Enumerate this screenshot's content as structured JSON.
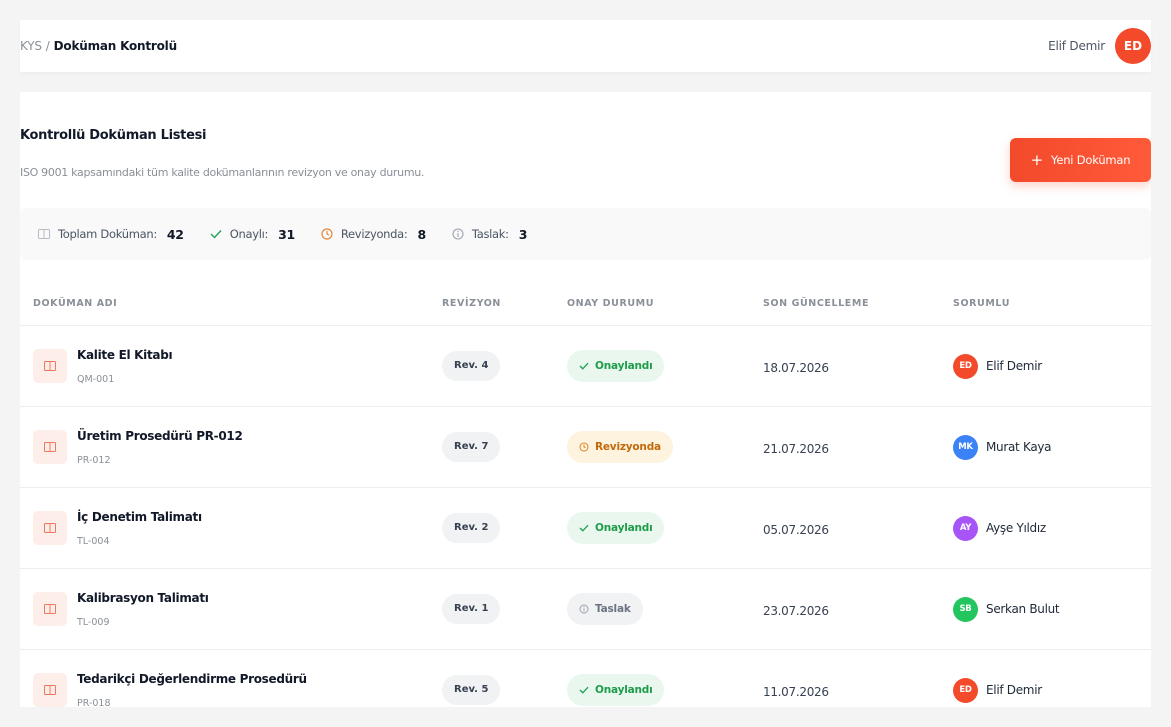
{
  "header": {
    "breadcrumb_root": "KYS",
    "breadcrumb_sep": "/",
    "breadcrumb_current": "Doküman Kontrolü",
    "user_name": "Elif Demir",
    "user_initials": "ED"
  },
  "page": {
    "title": "Kontrollü Doküman Listesi",
    "subtitle": "ISO 9001 kapsamındaki tüm kalite dokümanlarının revizyon ve onay durumu.",
    "new_button": "Yeni Doküman",
    "new_button_icon": "plus-icon"
  },
  "stats": [
    {
      "label": "Toplam Doküman:",
      "value": "42",
      "icon": "document-icon"
    },
    {
      "label": "Onaylı:",
      "value": "31",
      "icon": "check-icon"
    },
    {
      "label": "Revizyonda:",
      "value": "8",
      "icon": "clock-icon"
    },
    {
      "label": "Taslak:",
      "value": "3",
      "icon": "info-icon"
    }
  ],
  "table": {
    "columns": [
      "DOKÜMAN ADI",
      "REVİZYON",
      "ONAY DURUMU",
      "SON GÜNCELLEME",
      "SORUMLU"
    ],
    "rows": [
      {
        "name": "Kalite El Kitabı",
        "code": "QM-001",
        "revision": "Rev. 4",
        "status": "Onaylandı",
        "status_type": "approved",
        "updated": "18.07.2026",
        "owner": "Elif Demir",
        "owner_initials": "ED",
        "owner_color": "#f24a2b"
      },
      {
        "name": "Üretim Prosedürü PR-012",
        "code": "PR-012",
        "revision": "Rev. 7",
        "status": "Revizyonda",
        "status_type": "revision",
        "updated": "21.07.2026",
        "owner": "Murat Kaya",
        "owner_initials": "MK",
        "owner_color": "#3b82f6"
      },
      {
        "name": "İç Denetim Talimatı",
        "code": "TL-004",
        "revision": "Rev. 2",
        "status": "Onaylandı",
        "status_type": "approved",
        "updated": "05.07.2026",
        "owner": "Ayşe Yıldız",
        "owner_initials": "AY",
        "owner_color": "#a855f7"
      },
      {
        "name": "Kalibrasyon Talimatı",
        "code": "TL-009",
        "revision": "Rev. 1",
        "status": "Taslak",
        "status_type": "draft",
        "updated": "23.07.2026",
        "owner": "Serkan Bulut",
        "owner_initials": "SB",
        "owner_color": "#22c55e"
      },
      {
        "name": "Tedarikçi Değerlendirme Prosedürü",
        "code": "PR-018",
        "revision": "Rev. 5",
        "status": "Onaylandı",
        "status_type": "approved",
        "updated": "11.07.2026",
        "owner": "Elif Demir",
        "owner_initials": "ED",
        "owner_color": "#f24a2b"
      }
    ]
  },
  "colors": {
    "accent": "#f24a2b",
    "approved": "#1e9c4a",
    "revision": "#c26a0a",
    "draft": "#6b7280"
  }
}
